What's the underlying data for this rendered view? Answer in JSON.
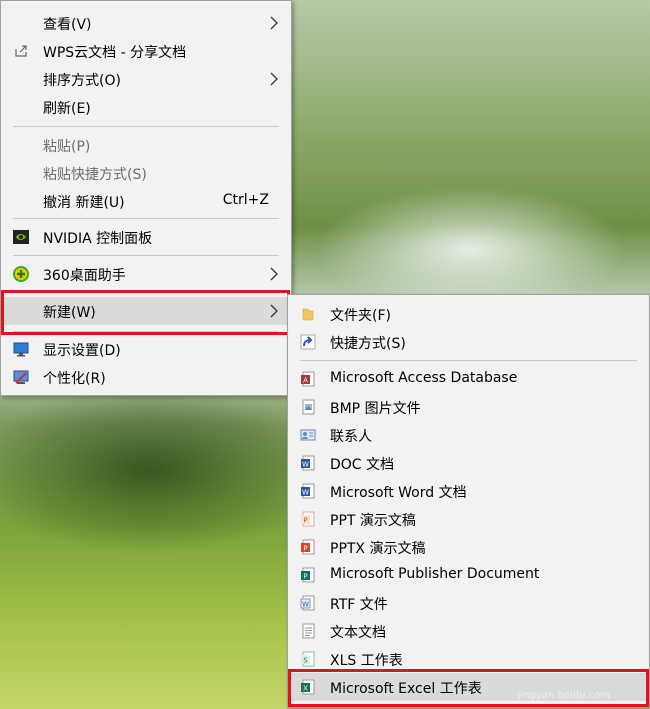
{
  "context_menu": {
    "items": [
      {
        "label": "查看(V)"
      },
      {
        "label": "WPS云文档 - 分享文档"
      },
      {
        "label": "排序方式(O)"
      },
      {
        "label": "刷新(E)"
      },
      {
        "label": "粘贴(P)"
      },
      {
        "label": "粘贴快捷方式(S)"
      },
      {
        "label": "撤消 新建(U)",
        "shortcut": "Ctrl+Z"
      },
      {
        "label": "NVIDIA 控制面板"
      },
      {
        "label": "360桌面助手"
      },
      {
        "label": "新建(W)"
      },
      {
        "label": "显示设置(D)"
      },
      {
        "label": "个性化(R)"
      }
    ]
  },
  "new_submenu": {
    "items": [
      {
        "label": "文件夹(F)",
        "icon": "folder-icon"
      },
      {
        "label": "快捷方式(S)",
        "icon": "shortcut-icon"
      },
      {
        "label": "Microsoft Access Database",
        "icon": "access-icon"
      },
      {
        "label": "BMP 图片文件",
        "icon": "bmp-icon"
      },
      {
        "label": "联系人",
        "icon": "contact-icon"
      },
      {
        "label": "DOC 文档",
        "icon": "word-icon"
      },
      {
        "label": "Microsoft Word 文档",
        "icon": "word-icon"
      },
      {
        "label": "PPT 演示文稿",
        "icon": "ppt-icon"
      },
      {
        "label": "PPTX 演示文稿",
        "icon": "ppt-icon"
      },
      {
        "label": "Microsoft Publisher Document",
        "icon": "publisher-icon"
      },
      {
        "label": "RTF 文件",
        "icon": "rtf-icon"
      },
      {
        "label": "文本文档",
        "icon": "text-icon"
      },
      {
        "label": "XLS 工作表",
        "icon": "xls-icon"
      },
      {
        "label": "Microsoft Excel 工作表",
        "icon": "excel-icon"
      }
    ]
  },
  "colors": {
    "highlight_border": "#e0141c",
    "menu_bg": "#f2f2f2"
  },
  "watermark": {
    "text": "jingyan.baidu.com"
  }
}
